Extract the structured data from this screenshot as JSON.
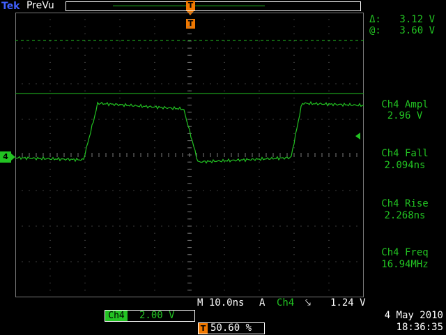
{
  "header": {
    "logo": "Tek",
    "mode": "PreVu",
    "trigger_marker": "T"
  },
  "cursors": {
    "delta_label": "Δ:",
    "delta_value": "3.12 V",
    "at_label": "@:",
    "at_value": "3.60 V"
  },
  "measurements": [
    {
      "label": "Ch4 Ampl",
      "value": "2.96 V"
    },
    {
      "label": "Ch4 Fall",
      "value": "2.094ns"
    },
    {
      "label": "Ch4 Rise",
      "value": "2.268ns"
    },
    {
      "label": "Ch4 Freq",
      "value": "16.94MHz"
    }
  ],
  "channel": {
    "ground_marker": "4",
    "tag": "Ch4",
    "scale": "2.00 V"
  },
  "timebase": "M 10.0ns",
  "trigger": {
    "mode": "A",
    "source": "Ch4",
    "slope": "⤥",
    "level": "1.24 V",
    "position_marker": "T",
    "position": "50.60 %"
  },
  "datetime": {
    "date": "4 May 2010",
    "time": "18:36:35"
  },
  "colors": {
    "trace": "#22c322",
    "trigger_marker": "#f07800",
    "logo": "#4060ff",
    "background": "#000000"
  }
}
